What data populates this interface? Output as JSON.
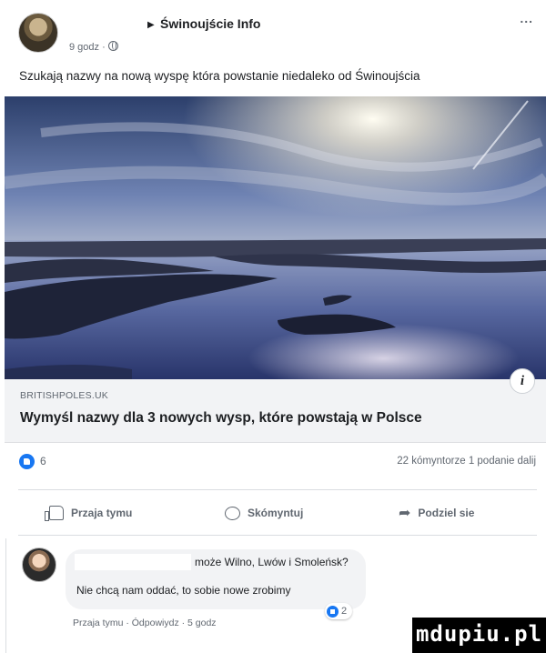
{
  "post": {
    "page_name": "Świnoujście Info",
    "time": "9 godz ·",
    "text": "Szukają nazwy na nową wyspę która powstanie niedaleko od Świnoujścia",
    "more_label": "..."
  },
  "link": {
    "domain": "BRITISHPOLES.UK",
    "title": "Wymyśl nazwy dla 3 nowych wysp, które powstają w Polsce",
    "info_label": "i"
  },
  "stats": {
    "likes": "6",
    "comments_shares": "22 kómyntorze   1 podanie dalij"
  },
  "actions": {
    "like": "Przaja tymu",
    "comment": "Skómyntuj",
    "share": "Podziel sie"
  },
  "comment": {
    "line1": "może Wilno, Lwów i Smoleńsk?",
    "line2": "Nie chcą nam oddać, to sobie nowe zrobimy",
    "reactions": "2",
    "meta": "Przaja tymu · Ódpowiydz · 5 godz"
  },
  "watermark": "mdupiu.pl",
  "colors": {
    "accent": "#1877f2",
    "text": "#1c1e21",
    "muted": "#606770",
    "link_box_bg": "#f2f3f5"
  },
  "icons": [
    "globe-icon",
    "more-icon",
    "info-icon",
    "like-icon",
    "thumb-up-icon",
    "comment-bubble-icon",
    "share-arrow-icon"
  ]
}
